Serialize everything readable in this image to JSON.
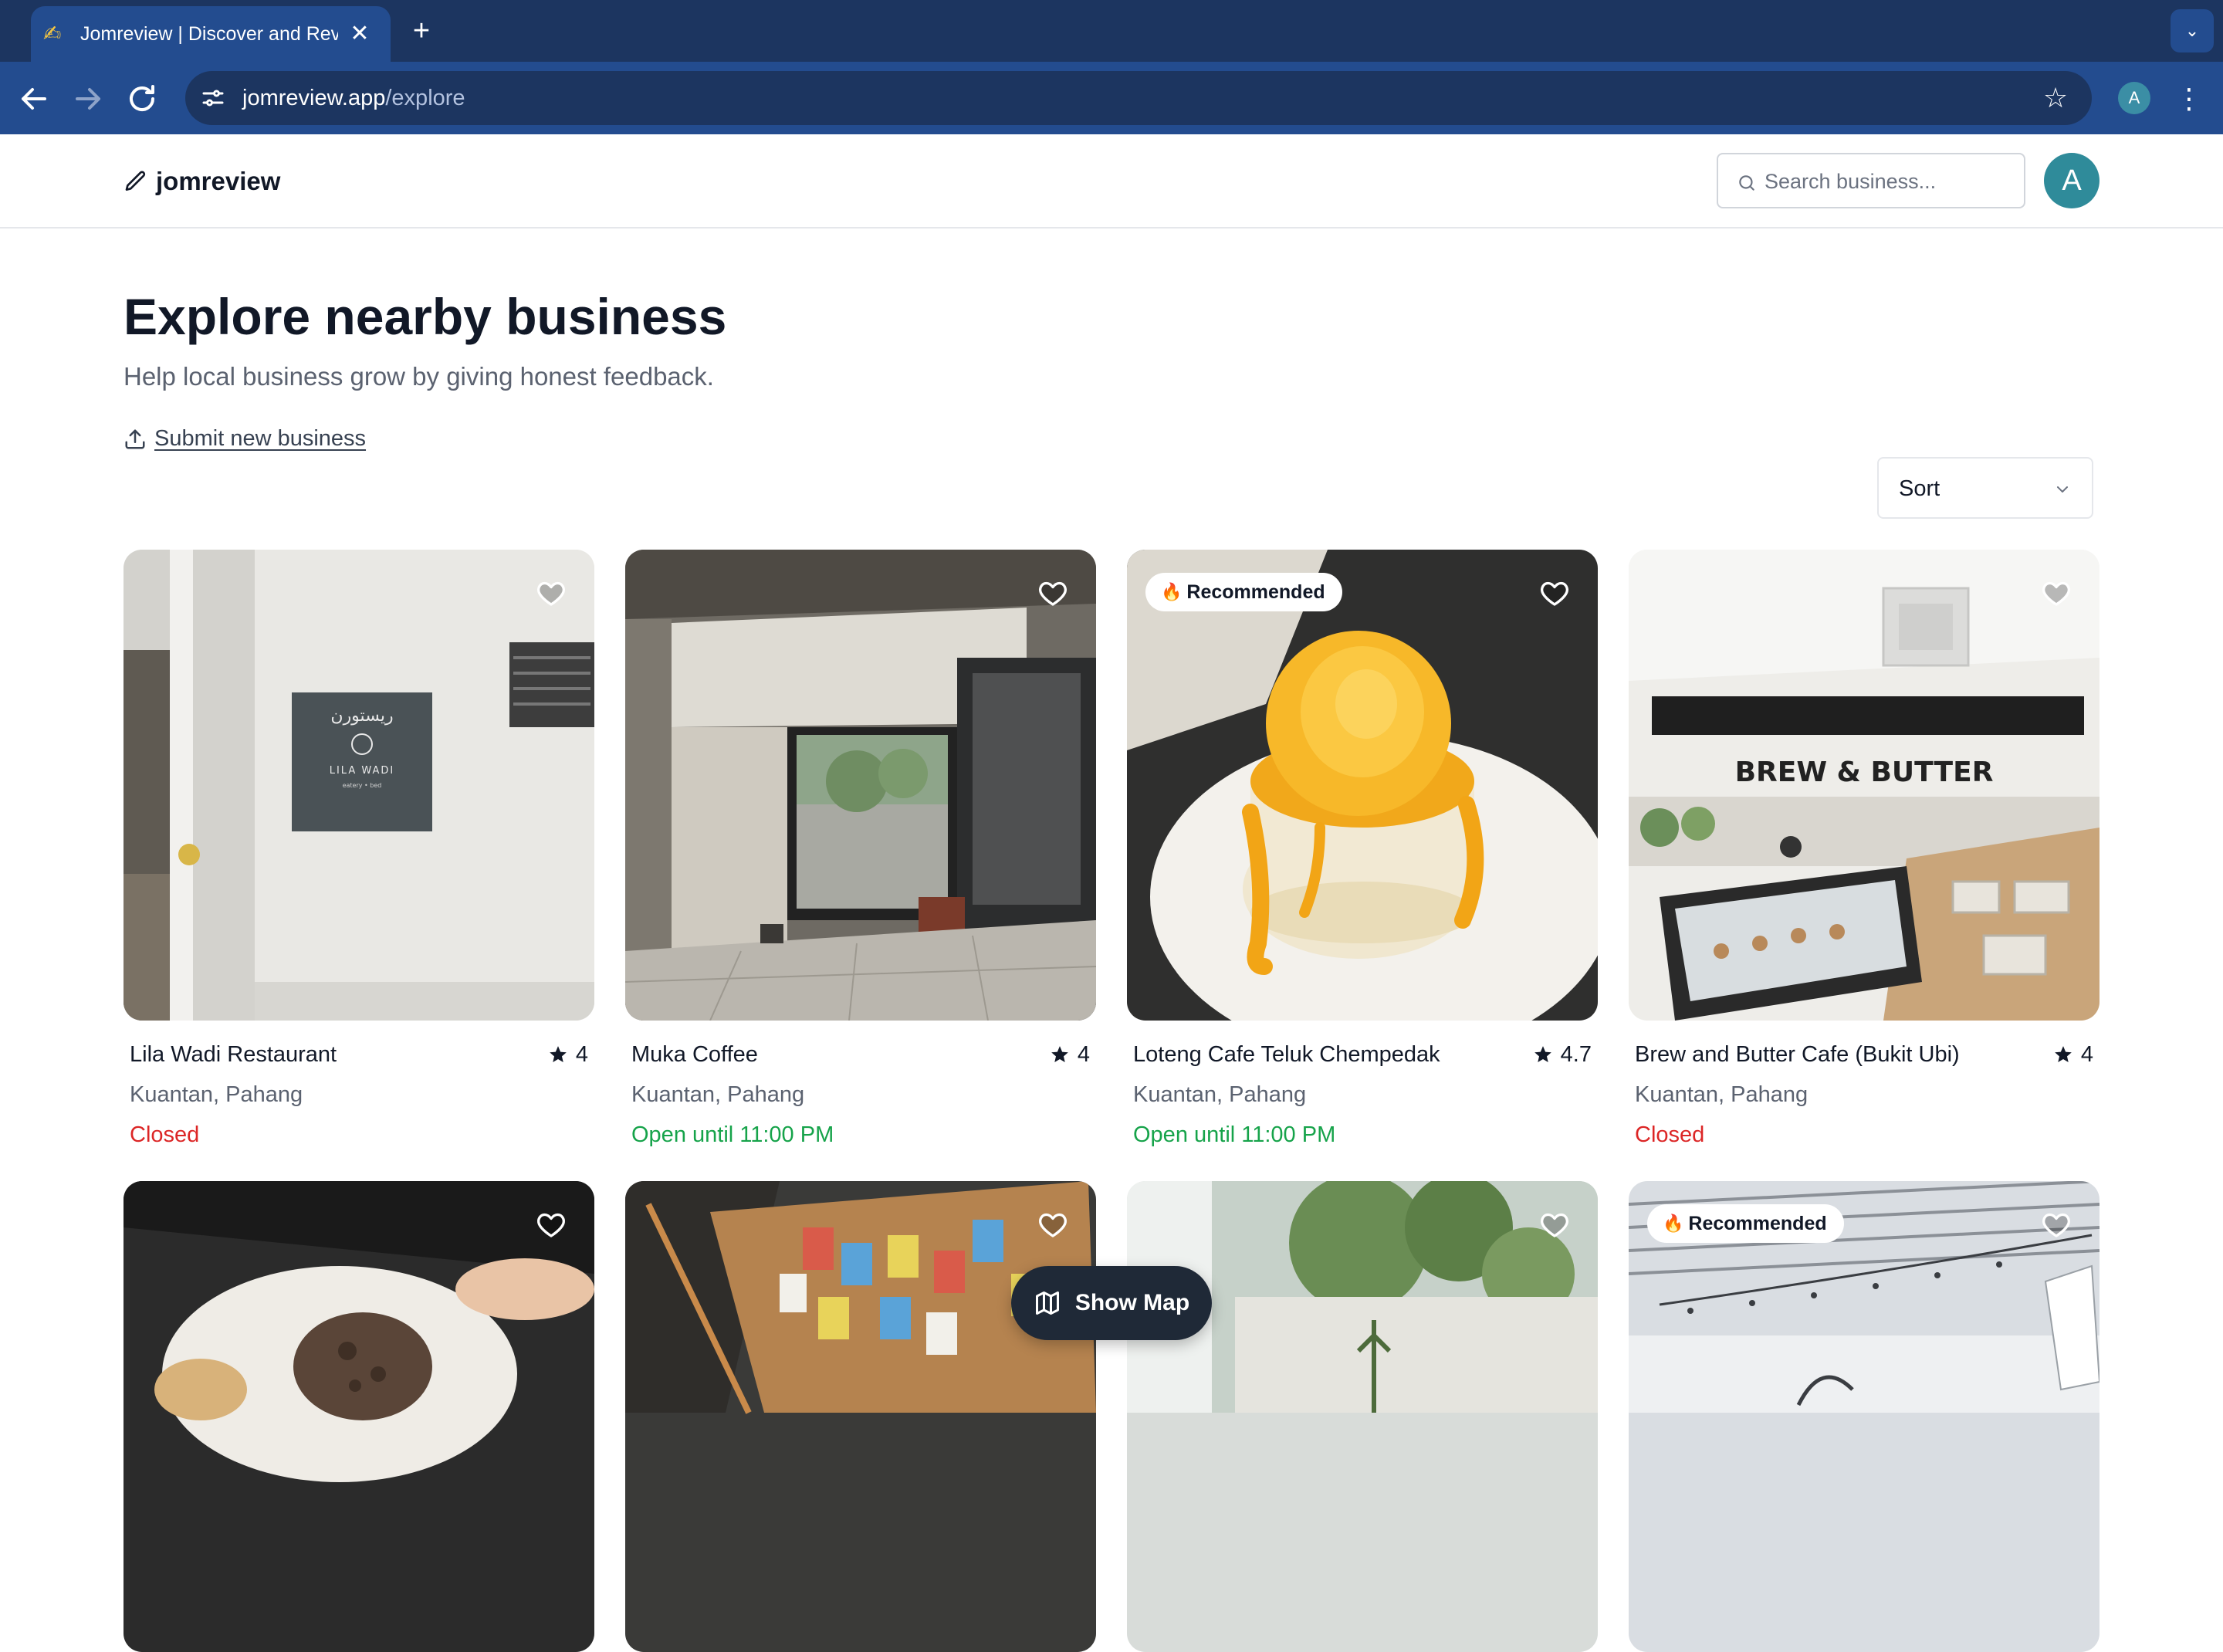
{
  "browser": {
    "tab_title": "Jomreview | Discover and Review",
    "url_domain": "jomreview.app",
    "url_path": "/explore",
    "profile_initial": "A"
  },
  "header": {
    "logo_text": "jomreview",
    "search_placeholder": "Search business...",
    "avatar_initial": "A"
  },
  "main": {
    "title": "Explore nearby business",
    "subtitle": "Help local business grow by giving honest feedback.",
    "submit_link": "Submit new business",
    "sort_label": "Sort",
    "show_map_label": "Show Map"
  },
  "badge_label": "Recommended",
  "cards": [
    {
      "name": "Lila Wadi Restaurant",
      "rating": "4",
      "location": "Kuantan, Pahang",
      "status": "Closed",
      "status_type": "closed",
      "recommended": false
    },
    {
      "name": "Muka Coffee",
      "rating": "4",
      "location": "Kuantan, Pahang",
      "status": "Open until 11:00 PM",
      "status_type": "open",
      "recommended": false
    },
    {
      "name": "Loteng Cafe Teluk Chempedak",
      "rating": "4.7",
      "location": "Kuantan, Pahang",
      "status": "Open until 11:00 PM",
      "status_type": "open",
      "recommended": true
    },
    {
      "name": "Brew and Butter Cafe (Bukit Ubi)",
      "rating": "4",
      "location": "Kuantan, Pahang",
      "status": "Closed",
      "status_type": "closed",
      "recommended": false
    }
  ],
  "photo_text": {
    "sign_arabic": "ريستورن",
    "sign_name": "LILA WADI",
    "sign_tagline": "eatery • bed",
    "brew_sign": "BREW & BUTTER"
  },
  "colors": {
    "brand_dark": "#111827",
    "avatar": "#2f8b9a",
    "closed": "#dc2626",
    "open": "#16a34a",
    "browser_frame": "#1c3560"
  }
}
